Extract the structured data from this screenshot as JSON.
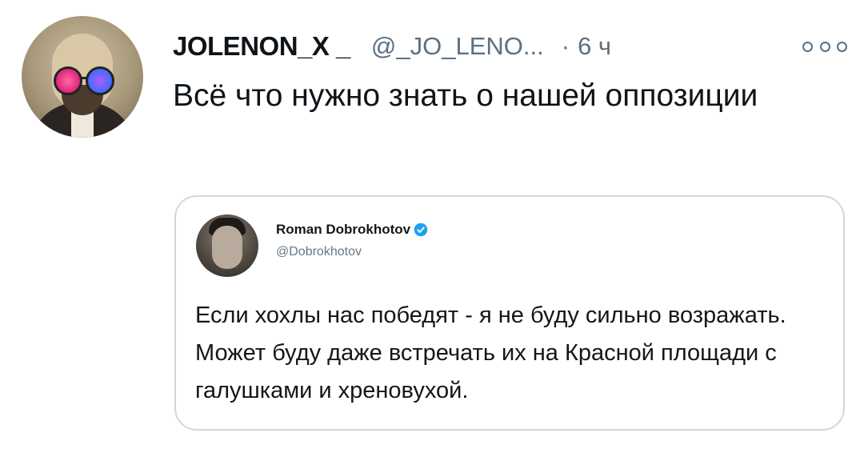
{
  "tweet": {
    "author_name": "JOLENON_X _",
    "author_handle": "@_JO_LENO...",
    "separator": "·",
    "time": "6 ч",
    "text": "Всё что нужно знать о нашей оппозиции"
  },
  "quoted_tweet": {
    "author_name": "Roman Dobrokhotov",
    "author_handle": "@Dobrokhotov",
    "verified": true,
    "text": "Если хохлы нас победят - я не буду сильно возражать. Может буду даже встречать их на Красной площади с галушками и хреновухой."
  },
  "icons": {
    "more": "more-horizontal-icon",
    "verified": "verified-badge-icon"
  },
  "colors": {
    "text": "#0f1419",
    "secondary": "#5b7083",
    "border": "#cfd9de",
    "verified": "#1da1f2"
  }
}
